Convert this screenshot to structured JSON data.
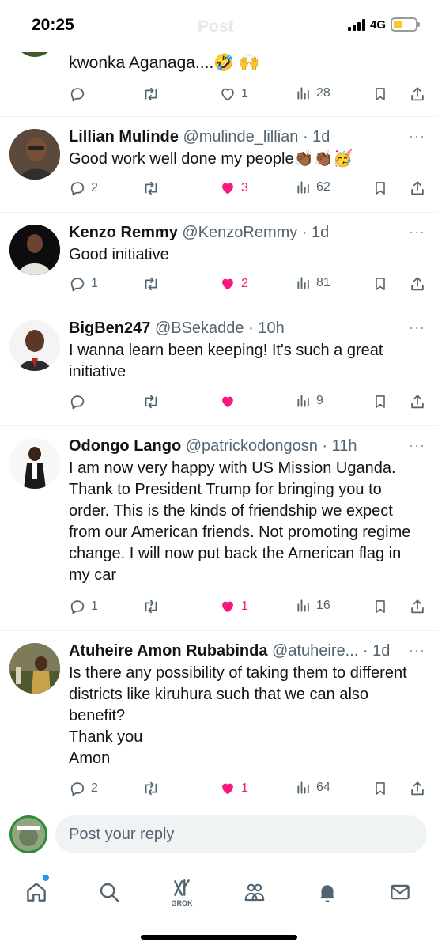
{
  "status_bar": {
    "time": "20:25",
    "ghost_title": "Post",
    "network": "4G"
  },
  "partial_tweet": {
    "text": "kwonka Aganaga....🤣 🙌",
    "views": "28",
    "likes": "1"
  },
  "tweets": [
    {
      "name": "Lillian Mulinde",
      "handle": "@mulinde_lillian",
      "time": "· 1d",
      "text": "Good work well done my people👏🏾👏🏾🥳",
      "replies": "2",
      "likes": "3",
      "views": "62",
      "liked": true
    },
    {
      "name": "Kenzo Remmy",
      "handle": "@KenzoRemmy",
      "time": "· 1d",
      "text": "Good initiative",
      "replies": "1",
      "likes": "2",
      "views": "81",
      "liked": true
    },
    {
      "name": "BigBen247",
      "handle": "@BSekadde",
      "time": "· 10h",
      "text": "I wanna learn been keeping! It's such a great initiative",
      "replies": "",
      "likes": "",
      "views": "9",
      "liked": true
    },
    {
      "name": "Odongo Lango",
      "handle": "@patrickodongosn",
      "time": "· 11h",
      "text": "I am now very happy with US Mission Uganda. Thank to President Trump for bringing you to order. This is the kinds of friendship we expect from our American friends. Not promoting regime change. I will now put back the American flag in my car",
      "replies": "1",
      "likes": "1",
      "views": "16",
      "liked": true
    },
    {
      "name": "Atuheire Amon Rubabinda",
      "handle": "@atuheire...",
      "time": "· 1d",
      "text": "Is there any possibility of taking them to different districts like kiruhura such that we can also benefit?\nThank you\nAmon",
      "replies": "2",
      "likes": "1",
      "views": "64",
      "liked": true
    }
  ],
  "more_label": "···",
  "reply_bar": {
    "placeholder": "Post your reply"
  },
  "bottom_nav": {
    "grok_label": "GROK"
  },
  "colors": {
    "like": "#f91880",
    "secondary": "#536471",
    "accent": "#1d9bf0"
  }
}
